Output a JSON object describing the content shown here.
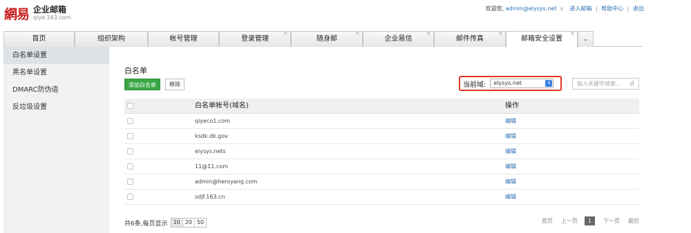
{
  "header": {
    "logo_mark": "網易",
    "logo_title": "企业邮箱",
    "logo_sub": "qiye.163.com",
    "welcome": "欢迎您,",
    "user": "admin@elysys.net",
    "user_dropdown": "∨",
    "enter_mail": "进入邮箱",
    "help": "帮助中心",
    "logout": "退出",
    "sep": "|"
  },
  "tabs": [
    {
      "label": "首页",
      "closable": false,
      "active": false
    },
    {
      "label": "组织架构",
      "closable": false,
      "active": false
    },
    {
      "label": "帐号管理",
      "closable": false,
      "active": false
    },
    {
      "label": "登录管理",
      "closable": true,
      "active": false
    },
    {
      "label": "随身邮",
      "closable": true,
      "active": false
    },
    {
      "label": "企业易信",
      "closable": true,
      "active": false
    },
    {
      "label": "邮件传真",
      "closable": true,
      "active": false
    },
    {
      "label": "邮箱安全设置",
      "closable": true,
      "active": true
    }
  ],
  "tab_close": "×",
  "tab_more": "⌄",
  "sidebar": {
    "items": [
      {
        "label": "白名单设置",
        "active": true
      },
      {
        "label": "黑名单设置",
        "active": false
      },
      {
        "label": "DMARC防伪造",
        "active": false
      },
      {
        "label": "反垃圾设置",
        "active": false
      }
    ]
  },
  "main": {
    "title": "白名单",
    "add_button": "添加白名单",
    "remove_button": "移除",
    "domain_label": "当前域:",
    "domain_value": "elysys.net",
    "search_placeholder": "输入关键字搜索...",
    "columns": {
      "account": "白名单帐号(域名)",
      "op": "操作"
    },
    "rows": [
      {
        "account": "qiyeco1.com",
        "op": "编辑"
      },
      {
        "account": "ksdk.dk.gov",
        "op": "编辑"
      },
      {
        "account": "elysys.nets",
        "op": "编辑"
      },
      {
        "account": "11@11.com",
        "op": "编辑"
      },
      {
        "account": "admin@heroyang.com",
        "op": "编辑"
      },
      {
        "account": "sdjf.163.cn",
        "op": "编辑"
      }
    ],
    "footer": {
      "total": "共6条,每页显示",
      "page_sizes": [
        "10",
        "20",
        "50"
      ],
      "selected_size": "10"
    },
    "pager": {
      "first": "首页",
      "prev": "上一页",
      "current": "1",
      "next": "下一页",
      "last": "最后"
    }
  },
  "colors": {
    "brand_red": "#c8201f",
    "add_green": "#3aa745",
    "highlight_border": "#e0331f",
    "link_blue": "#2a6fb0"
  }
}
